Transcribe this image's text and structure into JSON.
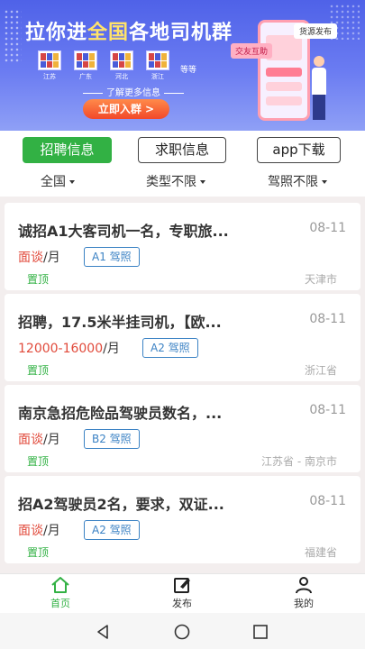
{
  "banner": {
    "title_prefix": "拉你进",
    "title_highlight": "全国",
    "title_suffix": "各地司机群",
    "regions": [
      "江苏",
      "广东",
      "河北",
      "浙江"
    ],
    "etc_label": "等等",
    "more_info": "了解更多信息",
    "join_button": "立即入群 >",
    "bubble_top": "货源发布",
    "bubble_side": "交友互助"
  },
  "tabs": [
    {
      "label": "招聘信息",
      "active": true
    },
    {
      "label": "求职信息",
      "active": false
    },
    {
      "label": "app下载",
      "active": false
    }
  ],
  "filters": [
    {
      "label": "全国"
    },
    {
      "label": "类型不限"
    },
    {
      "label": "驾照不限"
    }
  ],
  "jobs": [
    {
      "title": "诚招A1大客司机一名，专职旅...",
      "date": "08-11",
      "salary_value": "面谈",
      "salary_unit": "/月",
      "license": "A1 驾照",
      "pin": "置顶",
      "location": "天津市"
    },
    {
      "title": "招聘，17.5米半挂司机，【欧...",
      "date": "08-11",
      "salary_value": "12000-16000",
      "salary_unit": "/月",
      "license": "A2 驾照",
      "pin": "置顶",
      "location": "浙江省"
    },
    {
      "title": "南京急招危险品驾驶员数名，...",
      "date": "08-11",
      "salary_value": "面谈",
      "salary_unit": "/月",
      "license": "B2 驾照",
      "pin": "置顶",
      "location": "江苏省 - 南京市"
    },
    {
      "title": "招A2驾驶员2名，要求，双证...",
      "date": "08-11",
      "salary_value": "面谈",
      "salary_unit": "/月",
      "license": "A2 驾照",
      "pin": "置顶",
      "location": "福建省"
    }
  ],
  "bottom_nav": [
    {
      "label": "首页",
      "icon": "home-icon",
      "active": true
    },
    {
      "label": "发布",
      "icon": "edit-icon",
      "active": false
    },
    {
      "label": "我的",
      "icon": "user-icon",
      "active": false
    }
  ],
  "colors": {
    "accent_green": "#32b144",
    "salary_red": "#e14a3b",
    "license_blue": "#3b82c4",
    "banner_blue": "#4f62e8"
  }
}
